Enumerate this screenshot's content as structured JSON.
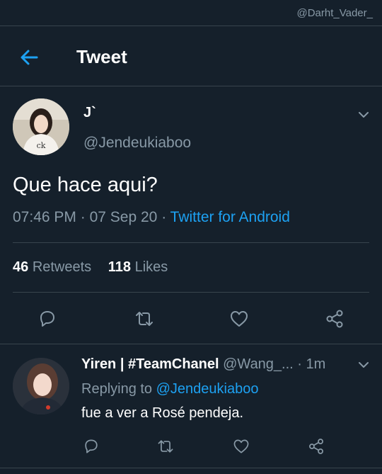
{
  "watermark": "@Darht_Vader_",
  "header": {
    "title": "Tweet"
  },
  "tweet": {
    "display_name": "J`",
    "handle": "@Jendeukiaboo",
    "text": "Que hace aqui?",
    "time": "07:46 PM",
    "date": "07 Sep 20",
    "separator": "·",
    "source": "Twitter for Android",
    "retweets_count": "46",
    "retweets_label": "Retweets",
    "likes_count": "118",
    "likes_label": "Likes"
  },
  "reply": {
    "display_name": "Yiren | #TeamChanel",
    "handle": "@Wang_...",
    "dot": "·",
    "time": "1m",
    "replying_prefix": "Replying to",
    "replying_mention": "@Jendeukiaboo",
    "text": "fue a ver a Rosé pendeja."
  },
  "colors": {
    "background": "#15202b",
    "accent": "#1da1f2",
    "secondary_text": "#8899a6",
    "border": "#38444d"
  },
  "icons": [
    "back-arrow-icon",
    "chevron-down-icon",
    "reply-icon",
    "retweet-icon",
    "like-icon",
    "share-icon"
  ]
}
